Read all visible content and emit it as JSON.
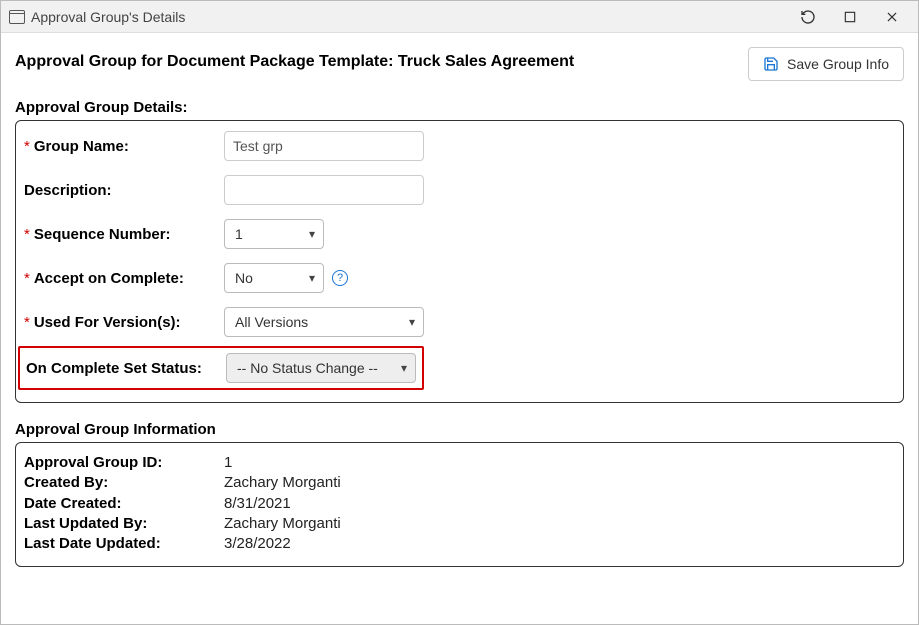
{
  "window": {
    "title": "Approval Group's Details"
  },
  "header": {
    "page_title": "Approval Group for Document Package Template: Truck Sales Agreement",
    "save_label": "Save Group Info"
  },
  "details": {
    "heading": "Approval Group Details:",
    "group_name_label": "Group Name:",
    "group_name_value": "Test grp",
    "description_label": "Description:",
    "description_value": "",
    "sequence_label": "Sequence Number:",
    "sequence_value": "1",
    "accept_label": "Accept on Complete:",
    "accept_value": "No",
    "versions_label": "Used For Version(s):",
    "versions_value": "All Versions",
    "status_label": "On Complete Set Status:",
    "status_value": "-- No Status Change --"
  },
  "info": {
    "heading": "Approval Group Information",
    "id_label": "Approval Group ID:",
    "id_value": "1",
    "created_by_label": "Created By:",
    "created_by_value": "Zachary Morganti",
    "date_created_label": "Date Created:",
    "date_created_value": "8/31/2021",
    "updated_by_label": "Last Updated By:",
    "updated_by_value": "Zachary Morganti",
    "updated_date_label": "Last Date Updated:",
    "updated_date_value": "3/28/2022"
  }
}
